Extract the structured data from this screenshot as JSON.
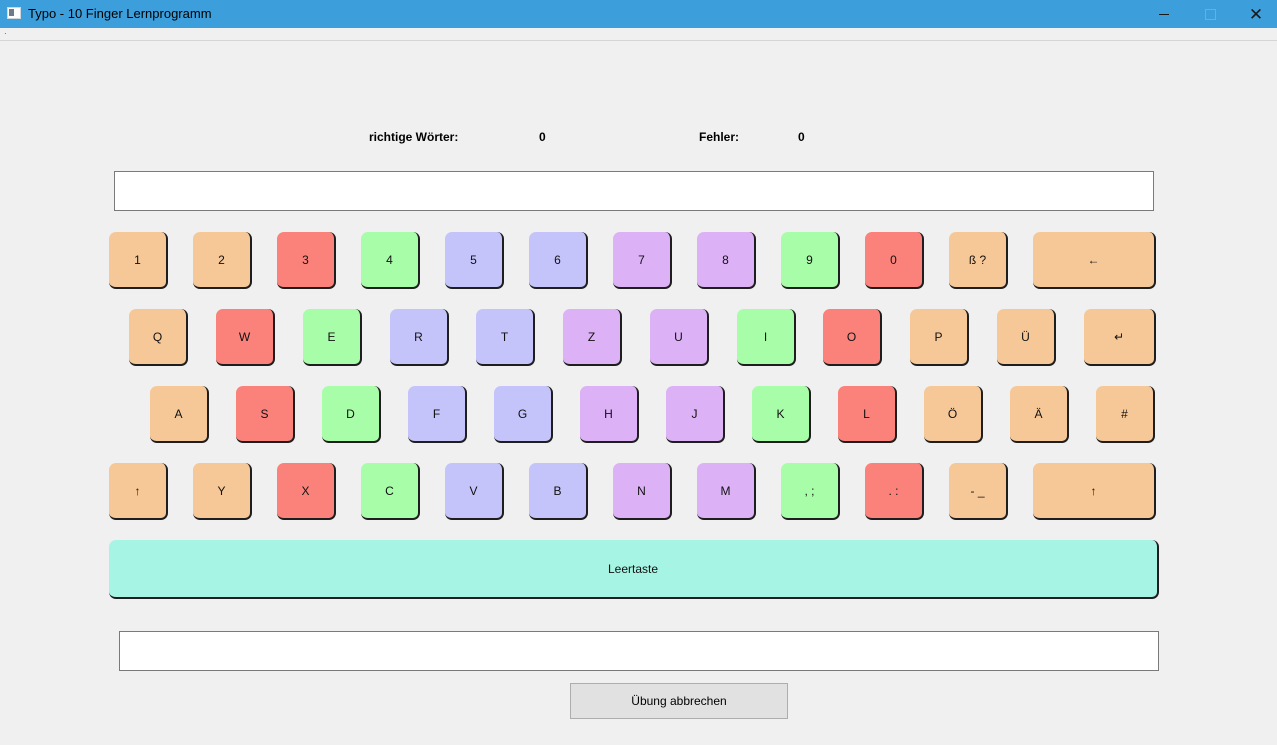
{
  "window": {
    "title": "Typo - 10 Finger Lernprogramm"
  },
  "stats": {
    "correct_label": "richtige Wörter:",
    "correct_value": "0",
    "errors_label": "Fehler:",
    "errors_value": "0"
  },
  "keyboard": {
    "rows": [
      [
        {
          "label": "1",
          "color": "orange"
        },
        {
          "label": "2",
          "color": "orange"
        },
        {
          "label": "3",
          "color": "red"
        },
        {
          "label": "4",
          "color": "green"
        },
        {
          "label": "5",
          "color": "blue"
        },
        {
          "label": "6",
          "color": "blue"
        },
        {
          "label": "7",
          "color": "purple"
        },
        {
          "label": "8",
          "color": "purple"
        },
        {
          "label": "9",
          "color": "green"
        },
        {
          "label": "0",
          "color": "red"
        },
        {
          "label": "ß ?",
          "color": "orange"
        },
        {
          "label": "←",
          "color": "orange"
        }
      ],
      [
        {
          "label": "Q",
          "color": "orange"
        },
        {
          "label": "W",
          "color": "red"
        },
        {
          "label": "E",
          "color": "green"
        },
        {
          "label": "R",
          "color": "blue"
        },
        {
          "label": "T",
          "color": "blue"
        },
        {
          "label": "Z",
          "color": "purple"
        },
        {
          "label": "U",
          "color": "purple"
        },
        {
          "label": "I",
          "color": "green"
        },
        {
          "label": "O",
          "color": "red"
        },
        {
          "label": "P",
          "color": "orange"
        },
        {
          "label": "Ü",
          "color": "orange"
        },
        {
          "label": "↵",
          "color": "orange"
        }
      ],
      [
        {
          "label": "A",
          "color": "orange"
        },
        {
          "label": "S",
          "color": "red"
        },
        {
          "label": "D",
          "color": "green"
        },
        {
          "label": "F",
          "color": "blue"
        },
        {
          "label": "G",
          "color": "blue"
        },
        {
          "label": "H",
          "color": "purple"
        },
        {
          "label": "J",
          "color": "purple"
        },
        {
          "label": "K",
          "color": "green"
        },
        {
          "label": "L",
          "color": "red"
        },
        {
          "label": "Ö",
          "color": "orange"
        },
        {
          "label": "Ä",
          "color": "orange"
        },
        {
          "label": "#",
          "color": "orange"
        }
      ],
      [
        {
          "label": "↑",
          "color": "orange"
        },
        {
          "label": "Y",
          "color": "orange"
        },
        {
          "label": "X",
          "color": "red"
        },
        {
          "label": "C",
          "color": "green"
        },
        {
          "label": "V",
          "color": "blue"
        },
        {
          "label": "B",
          "color": "blue"
        },
        {
          "label": "N",
          "color": "purple"
        },
        {
          "label": "M",
          "color": "purple"
        },
        {
          "label": ", ;",
          "color": "green"
        },
        {
          "label": ". :",
          "color": "red"
        },
        {
          "label": "- _",
          "color": "orange"
        },
        {
          "label": "↑",
          "color": "orange"
        }
      ]
    ],
    "space_label": "Leertaste"
  },
  "target_text": "",
  "input_text": "",
  "cancel_button": "Übung abbrechen",
  "colors": {
    "orange": "#f7c897",
    "red": "#fb827a",
    "green": "#a8fda8",
    "blue": "#c4c4fb",
    "purple": "#dcb1f5",
    "space": "#a6f4e3",
    "titlebar": "#3c9fdc"
  }
}
